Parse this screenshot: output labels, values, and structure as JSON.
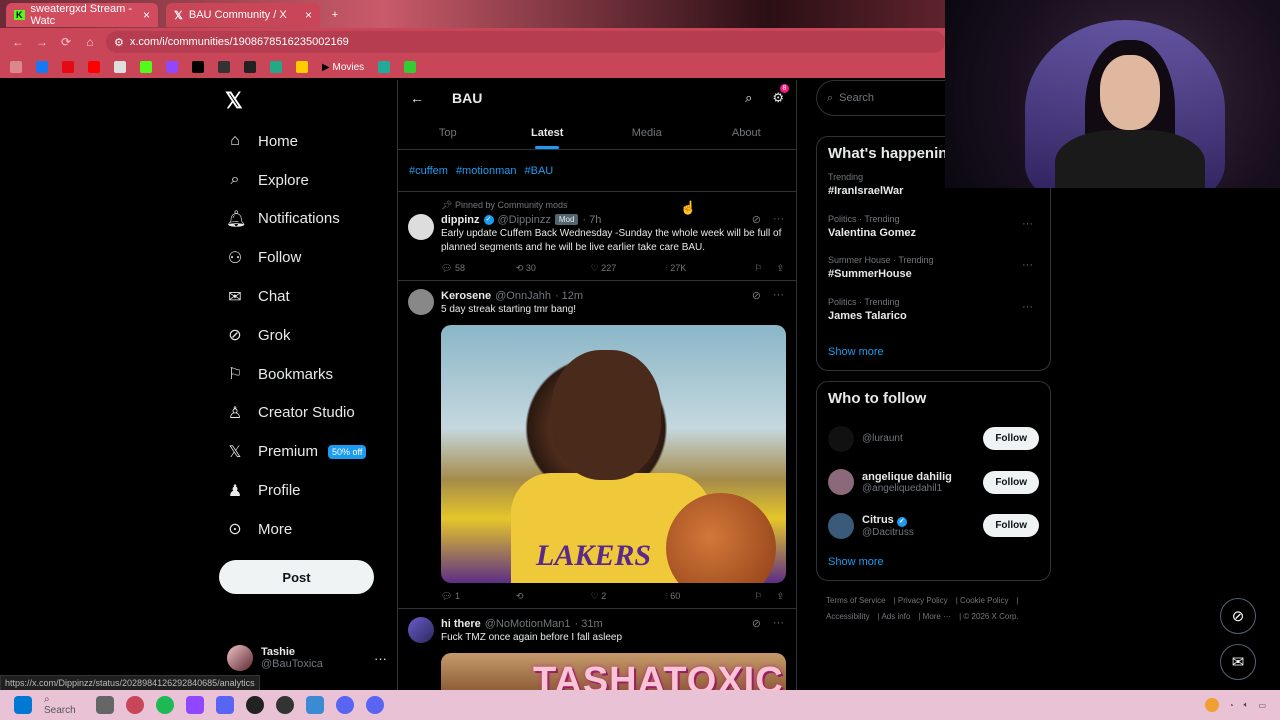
{
  "browser": {
    "tabs": [
      {
        "label": "sweatergxd Stream - Watc",
        "active": false
      },
      {
        "label": "BAU Community / X",
        "active": true
      }
    ],
    "url": "x.com/i/communities/1908678516235002169",
    "bookmarks": [
      "Movies"
    ],
    "status_url": "https://x.com/Dippinzz/status/2028984126292840685/analytics"
  },
  "sidebar": {
    "items": [
      {
        "label": "Home",
        "icon": "home-icon"
      },
      {
        "label": "Explore",
        "icon": "search-icon"
      },
      {
        "label": "Notifications",
        "icon": "bell-icon"
      },
      {
        "label": "Follow",
        "icon": "person-add-icon"
      },
      {
        "label": "Chat",
        "icon": "mail-icon"
      },
      {
        "label": "Grok",
        "icon": "grok-icon"
      },
      {
        "label": "Bookmarks",
        "icon": "bookmark-icon"
      },
      {
        "label": "Creator Studio",
        "icon": "studio-icon"
      },
      {
        "label": "Premium",
        "icon": "x-icon"
      },
      {
        "label": "Profile",
        "icon": "person-icon"
      },
      {
        "label": "More",
        "icon": "more-icon"
      }
    ],
    "premium_badge": "50% off",
    "post_label": "Post",
    "profile": {
      "name": "Tashie",
      "handle": "@BauToxica"
    }
  },
  "main": {
    "title": "BAU",
    "tabs": [
      "Top",
      "Latest",
      "Media",
      "About"
    ],
    "active_tab": "Latest",
    "hashtags": [
      "#cuffem",
      "#motionman",
      "#BAU"
    ],
    "posts": [
      {
        "pinned": "Pinned by Community mods",
        "name": "dippinz",
        "handle": "@Dippinzz",
        "badge": "Mod",
        "time": "· 7h",
        "text": "Early update Cuffem Back Wednesday -Sunday the whole week will be full of planned segments and he will be live earlier take care BAU.",
        "replies": "58",
        "reposts": "30",
        "likes": "227",
        "views": "27K"
      },
      {
        "name": "Kerosene",
        "handle": "@OnnJahh",
        "time": "· 12m",
        "text": "5 day streak starting tmr bang!",
        "replies": "1",
        "reposts": "",
        "likes": "2",
        "views": "60"
      },
      {
        "name": "hi there",
        "handle": "@NoMotionMan1",
        "time": "· 31m",
        "text": "Fuck TMZ once again before I fall asleep"
      }
    ]
  },
  "right": {
    "search_placeholder": "Search",
    "whats_happening": "What's happening",
    "trends": [
      {
        "category": "Trending",
        "title": "#IranIsraelWar"
      },
      {
        "category": "Politics · Trending",
        "title": "Valentina Gomez"
      },
      {
        "category": "Summer House · Trending",
        "title": "#SummerHouse"
      },
      {
        "category": "Politics · Trending",
        "title": "James Talarico"
      }
    ],
    "show_more": "Show more",
    "who_to_follow": "Who to follow",
    "follow_suggestions": [
      {
        "name": "",
        "handle": "@luraunt"
      },
      {
        "name": "angelique dahilig",
        "handle": "@angeliquedahil1"
      },
      {
        "name": "Citrus",
        "handle": "@Dacitruss",
        "verified": true
      }
    ],
    "follow_label": "Follow",
    "footer": [
      "Terms of Service",
      "Privacy Policy",
      "Cookie Policy",
      "Accessibility",
      "Ads info",
      "More ···",
      "© 2026 X Corp."
    ]
  },
  "overlay": {
    "watermark": "TASHATOXIC"
  },
  "colors": {
    "accent": "#1d9bf0",
    "browser": "#c84658",
    "taskbar": "#e9c2d5"
  }
}
